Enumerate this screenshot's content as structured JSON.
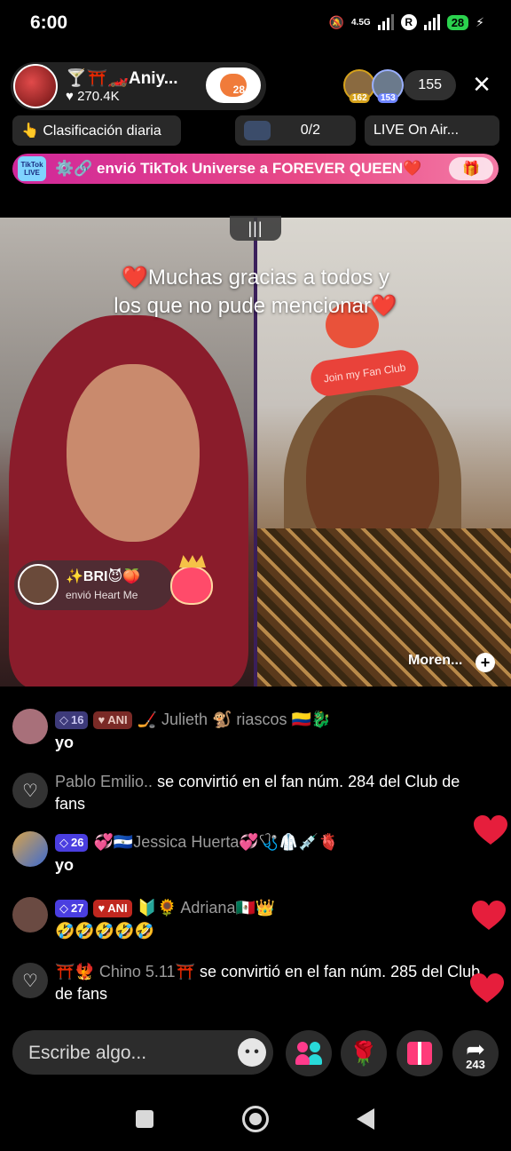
{
  "status_bar": {
    "time": "6:00",
    "network": "4.5G",
    "roaming": "R",
    "battery": "28"
  },
  "host": {
    "name": "🍸⛩️🏎️Aniy...",
    "likes": "♥ 270.4K",
    "fan_level": "28"
  },
  "viewers": {
    "top1_level": "162",
    "top2_level": "153",
    "count": "155"
  },
  "chips": {
    "daily_rank": "👆 Clasificación diaria",
    "match_progress": "0/2",
    "live_label": "LIVE On Air..."
  },
  "gift_banner": {
    "text": "⚙️🔗 envió TikTok Universe a FOREVER QUEEN❤️",
    "logo": "TikTok LIVE"
  },
  "video": {
    "split_icon": "|||",
    "caption_line1": "❤️Muchas gracias a todos y",
    "caption_line2": "los que no pude mencionar❤️",
    "fanclub_text": "Join my Fan Club",
    "gift_sender": "✨BRI😈🍑",
    "gift_action": "envió Heart Me",
    "guest_name": "Moren...",
    "guest_add": "+"
  },
  "comments": [
    {
      "level": "16",
      "fan_badge": "ANI",
      "user": "🏒 Julieth 🐒 riascos 🇨🇴🐉",
      "text": "yo"
    },
    {
      "user": "Pablo Emilio..",
      "message": " se convirtió en el fan núm. 284 del Club de fans"
    },
    {
      "level": "26",
      "user": "💞🇸🇻Jessica Huerta💞🩺🥼💉🫀",
      "text": "yo"
    },
    {
      "level": "27",
      "fan_badge": "ANI",
      "user": "🔰🌻 Adriana🇲🇽👑",
      "text": "🤣🤣🤣🤣🤣"
    },
    {
      "user": "⛩️🐦‍🔥 Chino 5.11⛩️",
      "message": " se convirtió en el fan núm. 285 del Club de fans"
    }
  ],
  "input": {
    "placeholder": "Escribe algo..."
  },
  "actions": {
    "share_count": "243"
  },
  "colors": {
    "accent_pink": "#e84a86",
    "heart_red": "#e61e3c",
    "level_badge": "#4a3ee0",
    "fan_badge": "#c0271f"
  }
}
